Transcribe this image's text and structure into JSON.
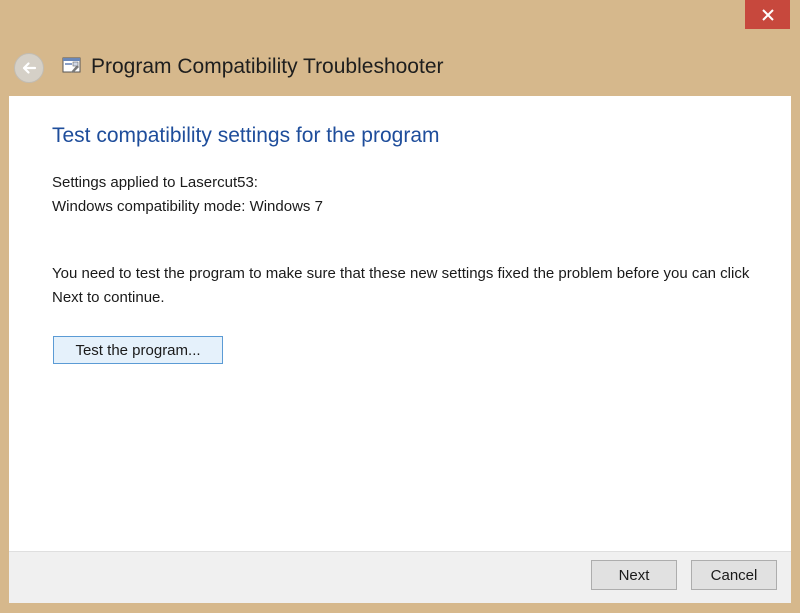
{
  "window": {
    "title": "Program Compatibility Troubleshooter",
    "close_icon": "close-icon",
    "back_icon": "back-arrow-icon",
    "app_icon": "troubleshooter-icon",
    "accent_color": "#1e4d9b",
    "frame_color": "#d6b88c",
    "close_color": "#c7483d"
  },
  "main": {
    "heading": "Test compatibility settings for the program",
    "settings_applied": "Settings applied to Lasercut53:",
    "compat_mode": "Windows compatibility mode: Windows 7",
    "info_text": "You need to test the program to make sure that these new settings fixed the problem before you can click Next to continue.",
    "test_button": "Test the program..."
  },
  "footer": {
    "next_label": "Next",
    "cancel_label": "Cancel"
  }
}
